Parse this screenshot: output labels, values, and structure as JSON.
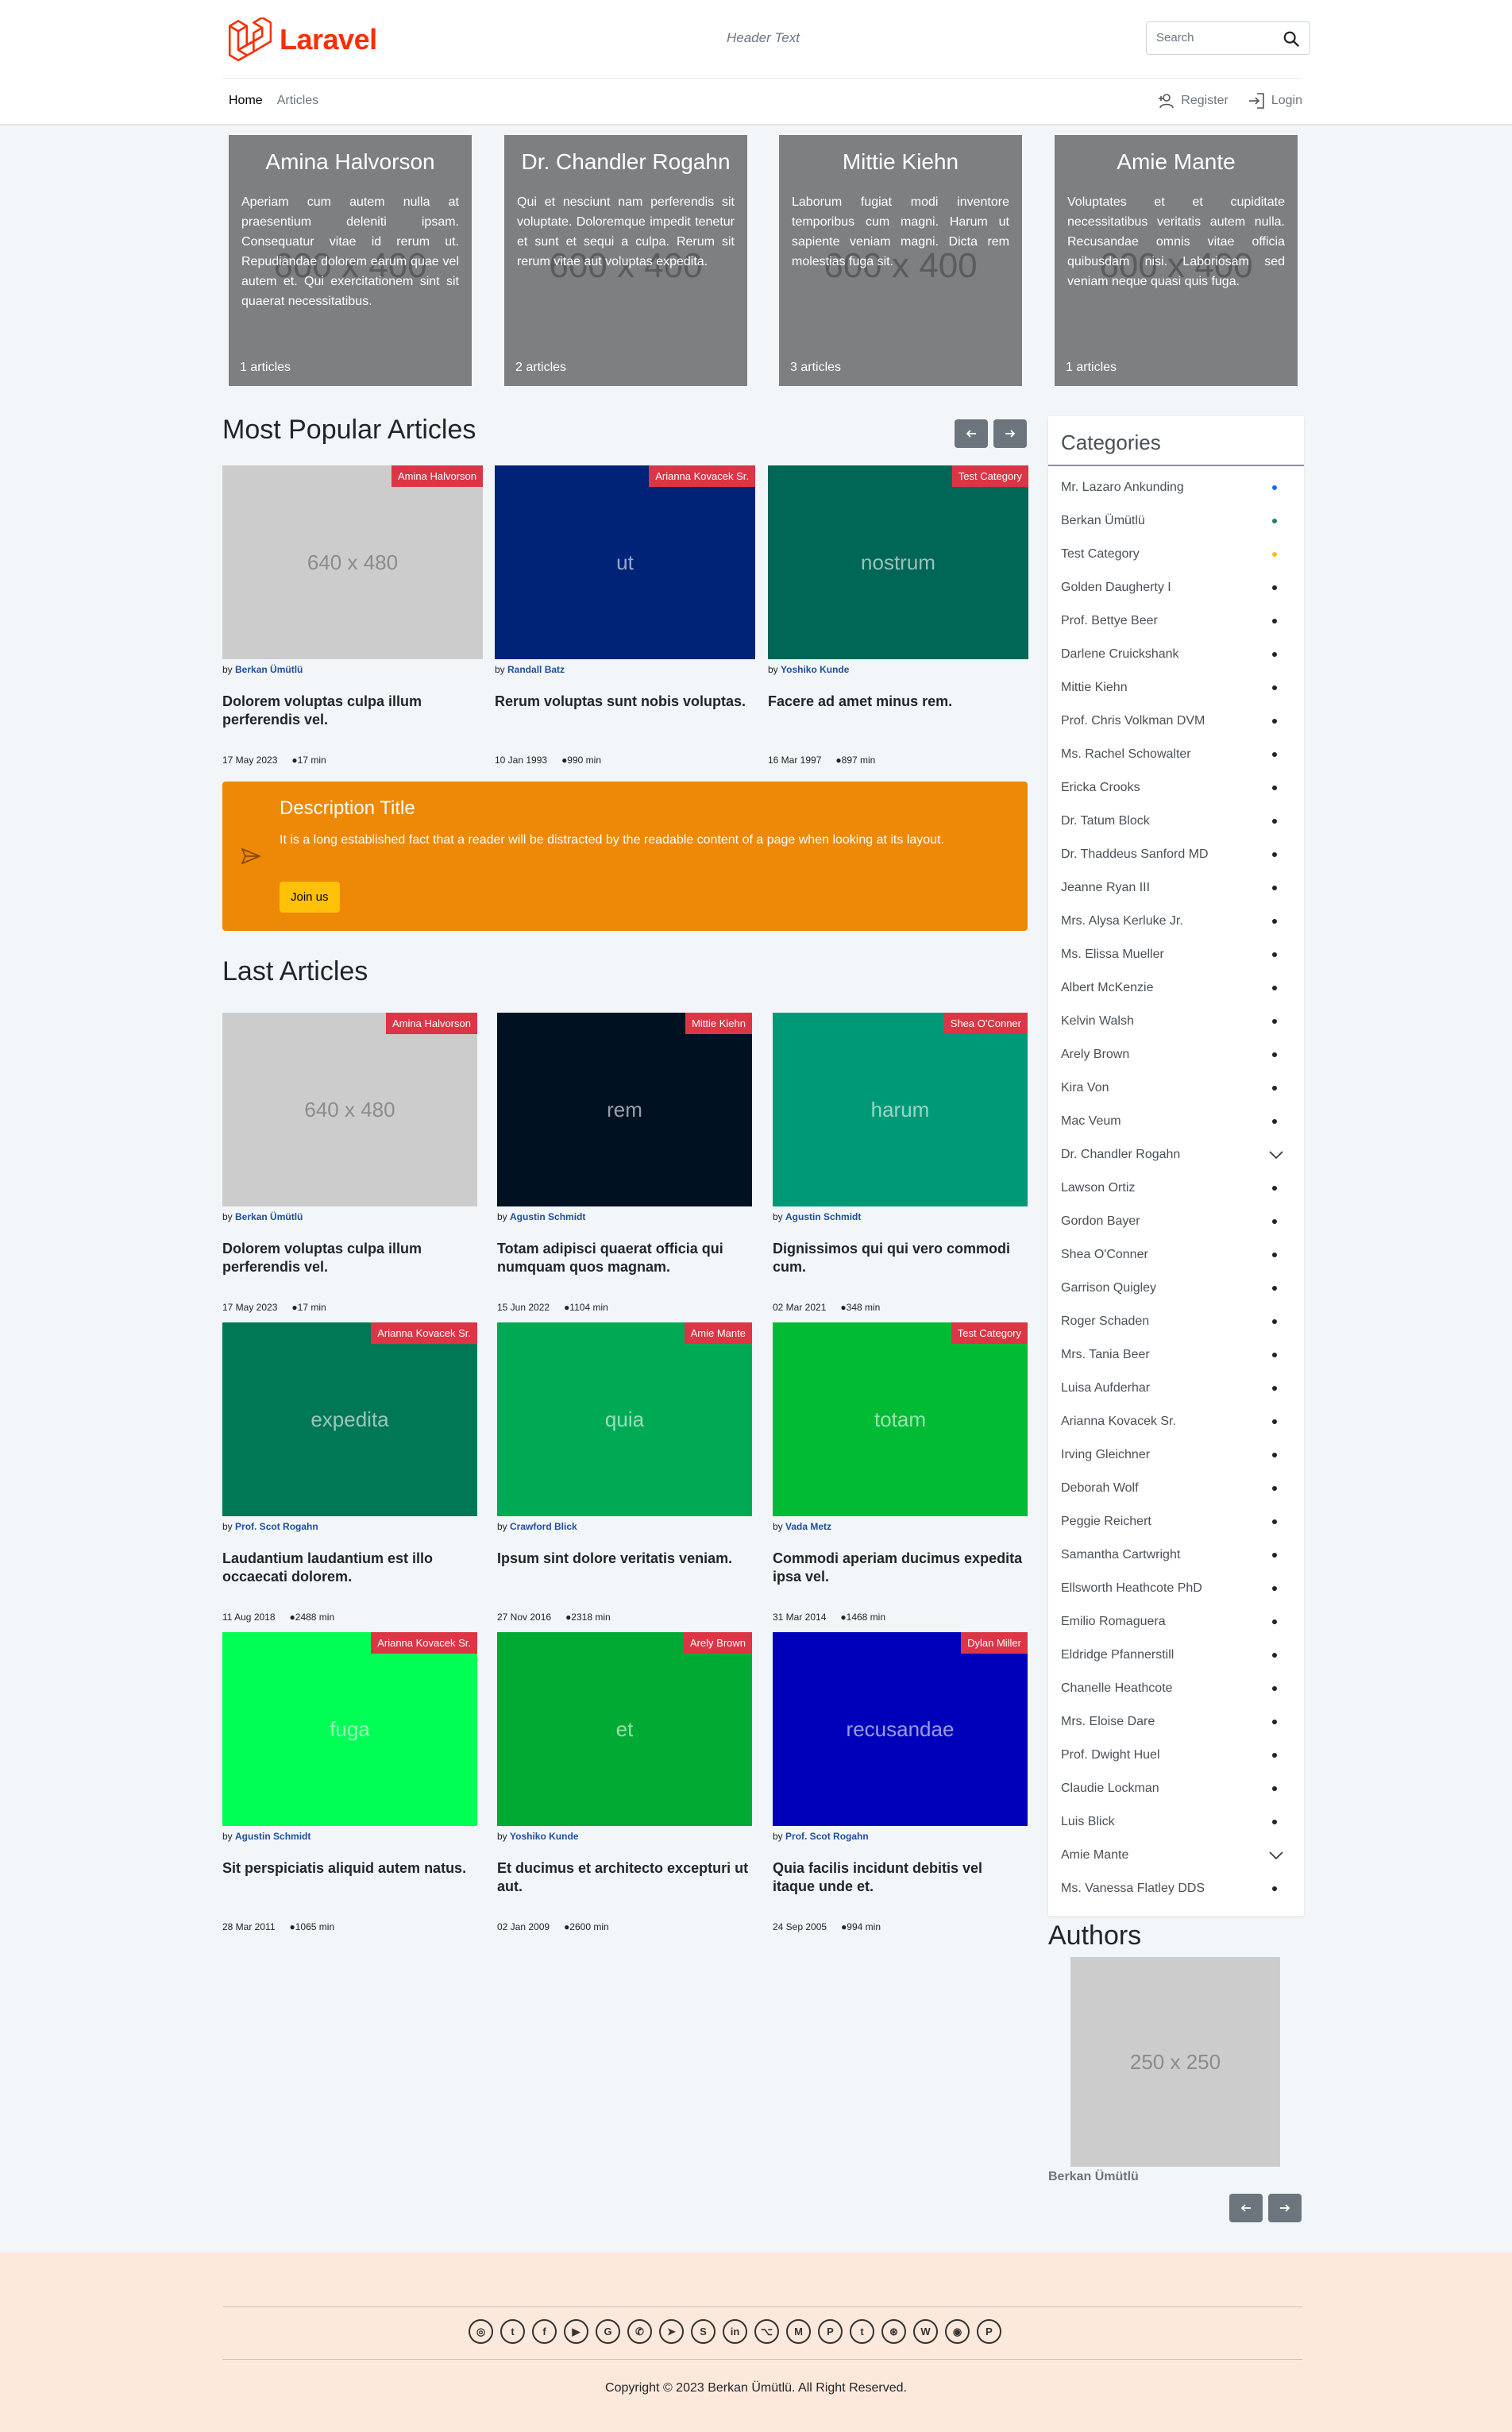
{
  "header": {
    "logo_text": "Laravel",
    "center_text": "Header Text",
    "search_placeholder": "Search",
    "nav": [
      {
        "label": "Home"
      },
      {
        "label": "Articles"
      }
    ],
    "auth": {
      "register": "Register",
      "login": "Login"
    }
  },
  "category_cards": [
    {
      "title": "Amina Halvorson",
      "placeholder": "600 x 400",
      "text": "Aperiam cum autem nulla at praesentium deleniti ipsam. Consequatur vitae id rerum ut. Repudiandae dolorem earum quae vel autem et. Qui exercitationem sint sit quaerat necessitatibus.",
      "count": "1 articles"
    },
    {
      "title": "Dr. Chandler Rogahn",
      "placeholder": "600 x 400",
      "text": "Qui et nesciunt nam perferendis sit voluptate. Doloremque impedit tenetur et sunt et sequi a culpa. Rerum sit rerum vitae aut voluptas expedita.",
      "count": "2 articles"
    },
    {
      "title": "Mittie Kiehn",
      "placeholder": "600 x 400",
      "text": "Laborum fugiat modi inventore temporibus cum magni. Harum ut sapiente veniam magni. Dicta rem molestias fuga sit.",
      "count": "3 articles"
    },
    {
      "title": "Amie Mante",
      "placeholder": "600 x 400",
      "text": "Voluptates et et cupiditate necessitatibus veritatis autem nulla. Recusandae omnis vitae officia quibusdam nisi. Laboriosam sed veniam neque quasi quis fuga.",
      "count": "1 articles"
    }
  ],
  "popular": {
    "title": "Most Popular Articles",
    "articles": [
      {
        "tag": "Amina Halvorson",
        "image_text": "640 x 480",
        "color": "#cccccc",
        "author": "Berkan Ümütlü",
        "title": "Dolorem voluptas culpa illum perferendis vel.",
        "date": "17 May 2023",
        "read": "●17 min"
      },
      {
        "tag": "Arianna Kovacek Sr.",
        "image_text": "ut",
        "color": "#002277",
        "author": "Randall Batz",
        "title": "Rerum voluptas sunt nobis voluptas.",
        "date": "10 Jan 1993",
        "read": "●990 min"
      },
      {
        "tag": "Test Category",
        "image_text": "nostrum",
        "color": "#006655",
        "author": "Yoshiko Kunde",
        "title": "Facere ad amet minus rem.",
        "date": "16 Mar 1997",
        "read": "●897 min"
      }
    ]
  },
  "banner": {
    "title": "Description Title",
    "text": "It is a long established fact that a reader will be distracted by the readable content of a page when looking at its layout.",
    "button": "Join us"
  },
  "last": {
    "title": "Last Articles",
    "articles": [
      {
        "tag": "Amina Halvorson",
        "image_text": "640 x 480",
        "color": "#cccccc",
        "author": "Berkan Ümütlü",
        "title": "Dolorem voluptas culpa illum perferendis vel.",
        "date": "17 May 2023",
        "read": "●17 min"
      },
      {
        "tag": "Mittie Kiehn",
        "image_text": "rem",
        "color": "#001122",
        "author": "Agustin Schmidt",
        "title": "Totam adipisci quaerat officia qui numquam quos magnam.",
        "date": "15 Jun 2022",
        "read": "●1104 min"
      },
      {
        "tag": "Shea O'Conner",
        "image_text": "harum",
        "color": "#009977",
        "author": "Agustin Schmidt",
        "title": "Dignissimos qui qui vero commodi cum.",
        "date": "02 Mar 2021",
        "read": "●348 min"
      },
      {
        "tag": "Arianna Kovacek Sr.",
        "image_text": "expedita",
        "color": "#007755",
        "author": "Prof. Scot Rogahn",
        "title": "Laudantium laudantium est illo occaecati dolorem.",
        "date": "11 Aug 2018",
        "read": "●2488 min"
      },
      {
        "tag": "Amie Mante",
        "image_text": "quia",
        "color": "#00aa55",
        "author": "Crawford Blick",
        "title": "Ipsum sint dolore veritatis veniam.",
        "date": "27 Nov 2016",
        "read": "●2318 min"
      },
      {
        "tag": "Test Category",
        "image_text": "totam",
        "color": "#00bb33",
        "author": "Vada Metz",
        "title": "Commodi aperiam ducimus expedita ipsa vel.",
        "date": "31 Mar 2014",
        "read": "●1468 min"
      },
      {
        "tag": "Arianna Kovacek Sr.",
        "image_text": "fuga",
        "color": "#00ff55",
        "author": "Agustin Schmidt",
        "title": "Sit perspiciatis aliquid autem natus.",
        "date": "28 Mar 2011",
        "read": "●1065 min"
      },
      {
        "tag": "Arely Brown",
        "image_text": "et",
        "color": "#00aa33",
        "author": "Yoshiko Kunde",
        "title": "Et ducimus et architecto excepturi ut aut.",
        "date": "02 Jan 2009",
        "read": "●2600 min"
      },
      {
        "tag": "Dylan Miller",
        "image_text": "recusandae",
        "color": "#0000bb",
        "author": "Prof. Scot Rogahn",
        "title": "Quia facilis incidunt debitis vel itaque unde et.",
        "date": "24 Sep 2005",
        "read": "●994 min"
      }
    ]
  },
  "sidebar": {
    "title": "Categories",
    "items": [
      {
        "label": "Mr. Lazaro Ankunding",
        "marker": "dot",
        "color": "#0d6efd"
      },
      {
        "label": "Berkan Ümütlü",
        "marker": "dot",
        "color": "#198754"
      },
      {
        "label": "Test Category",
        "marker": "dot",
        "color": "#ffc107"
      },
      {
        "label": "Golden Daugherty I",
        "marker": "dot",
        "color": "#212529"
      },
      {
        "label": "Prof. Bettye Beer",
        "marker": "dot",
        "color": "#212529"
      },
      {
        "label": "Darlene Cruickshank",
        "marker": "dot",
        "color": "#212529"
      },
      {
        "label": "Mittie Kiehn",
        "marker": "dot",
        "color": "#212529"
      },
      {
        "label": "Prof. Chris Volkman DVM",
        "marker": "dot",
        "color": "#212529"
      },
      {
        "label": "Ms. Rachel Schowalter",
        "marker": "dot",
        "color": "#212529"
      },
      {
        "label": "Ericka Crooks",
        "marker": "dot",
        "color": "#212529"
      },
      {
        "label": "Dr. Tatum Block",
        "marker": "dot",
        "color": "#212529"
      },
      {
        "label": "Dr. Thaddeus Sanford MD",
        "marker": "dot",
        "color": "#212529"
      },
      {
        "label": "Jeanne Ryan III",
        "marker": "dot",
        "color": "#212529"
      },
      {
        "label": "Mrs. Alysa Kerluke Jr.",
        "marker": "dot",
        "color": "#212529"
      },
      {
        "label": "Ms. Elissa Mueller",
        "marker": "dot",
        "color": "#212529"
      },
      {
        "label": "Albert McKenzie",
        "marker": "dot",
        "color": "#212529"
      },
      {
        "label": "Kelvin Walsh",
        "marker": "dot",
        "color": "#212529"
      },
      {
        "label": "Arely Brown",
        "marker": "dot",
        "color": "#212529"
      },
      {
        "label": "Kira Von",
        "marker": "dot",
        "color": "#212529"
      },
      {
        "label": "Mac Veum",
        "marker": "dot",
        "color": "#212529"
      },
      {
        "label": "Dr. Chandler Rogahn",
        "marker": "chevron",
        "color": "#212529"
      },
      {
        "label": "Lawson Ortiz",
        "marker": "dot",
        "color": "#212529"
      },
      {
        "label": "Gordon Bayer",
        "marker": "dot",
        "color": "#212529"
      },
      {
        "label": "Shea O'Conner",
        "marker": "dot",
        "color": "#212529"
      },
      {
        "label": "Garrison Quigley",
        "marker": "dot",
        "color": "#212529"
      },
      {
        "label": "Roger Schaden",
        "marker": "dot",
        "color": "#212529"
      },
      {
        "label": "Mrs. Tania Beer",
        "marker": "dot",
        "color": "#212529"
      },
      {
        "label": "Luisa Aufderhar",
        "marker": "dot",
        "color": "#212529"
      },
      {
        "label": "Arianna Kovacek Sr.",
        "marker": "dot",
        "color": "#212529"
      },
      {
        "label": "Irving Gleichner",
        "marker": "dot",
        "color": "#212529"
      },
      {
        "label": "Deborah Wolf",
        "marker": "dot",
        "color": "#212529"
      },
      {
        "label": "Peggie Reichert",
        "marker": "dot",
        "color": "#212529"
      },
      {
        "label": "Samantha Cartwright",
        "marker": "dot",
        "color": "#212529"
      },
      {
        "label": "Ellsworth Heathcote PhD",
        "marker": "dot",
        "color": "#212529"
      },
      {
        "label": "Emilio Romaguera",
        "marker": "dot",
        "color": "#212529"
      },
      {
        "label": "Eldridge Pfannerstill",
        "marker": "dot",
        "color": "#212529"
      },
      {
        "label": "Chanelle Heathcote",
        "marker": "dot",
        "color": "#212529"
      },
      {
        "label": "Mrs. Eloise Dare",
        "marker": "dot",
        "color": "#212529"
      },
      {
        "label": "Prof. Dwight Huel",
        "marker": "dot",
        "color": "#212529"
      },
      {
        "label": "Claudie Lockman",
        "marker": "dot",
        "color": "#212529"
      },
      {
        "label": "Luis Blick",
        "marker": "dot",
        "color": "#212529"
      },
      {
        "label": "Amie Mante",
        "marker": "chevron",
        "color": "#212529"
      },
      {
        "label": "Ms. Vanessa Flatley DDS",
        "marker": "dot",
        "color": "#212529"
      }
    ]
  },
  "authors": {
    "title": "Authors",
    "image_text": "250 x 250",
    "name": "Berkan Ümütlü"
  },
  "footer": {
    "social_icons": [
      "instagram-icon",
      "twitter-icon",
      "facebook-icon",
      "youtube-icon",
      "google-icon",
      "whatsapp-icon",
      "telegram-icon",
      "skype-icon",
      "linkedin-icon",
      "github-icon",
      "medium-icon",
      "pinterest-icon",
      "tumblr-icon",
      "dribbble-icon",
      "wordpress-icon",
      "discord-icon",
      "paypal-icon"
    ],
    "social_glyphs": [
      "◎",
      "t",
      "f",
      "▶",
      "G",
      "✆",
      "➤",
      "S",
      "in",
      "⌥",
      "M",
      "P",
      "t",
      "⊛",
      "W",
      "◉",
      "P"
    ],
    "copyright": "Copyright © 2023 Berkan Ümütlü. All Right Reserved."
  }
}
